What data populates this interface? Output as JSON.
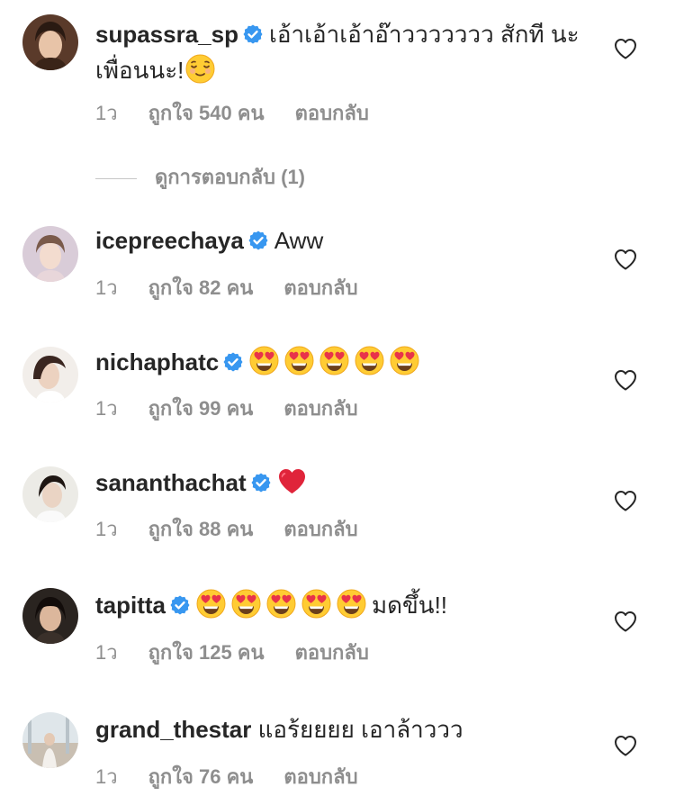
{
  "comments": [
    {
      "username": "supassra_sp",
      "text": "เอ้าเอ้าเอ้าอ๊าววววววว สักที นะเพื่อนนะ!",
      "trailing_emoji": "relieved-face",
      "time": "1ว",
      "likes": "ถูกใจ 540 คน",
      "reply": "ตอบกลับ"
    },
    {
      "username": "icepreechaya",
      "text": "Aww",
      "time": "1ว",
      "likes": "ถูกใจ 82 คน",
      "reply": "ตอบกลับ"
    },
    {
      "username": "nichaphatc",
      "text": "",
      "emojis": [
        "heart-eyes",
        "heart-eyes",
        "heart-eyes",
        "heart-eyes",
        "heart-eyes"
      ],
      "time": "1ว",
      "likes": "ถูกใจ 99 คน",
      "reply": "ตอบกลับ"
    },
    {
      "username": "sananthachat",
      "text": "",
      "emojis": [
        "red-heart"
      ],
      "time": "1ว",
      "likes": "ถูกใจ 88 คน",
      "reply": "ตอบกลับ"
    },
    {
      "username": "tapitta",
      "text": "มดขึ้น!!",
      "emojis": [
        "heart-eyes",
        "heart-eyes",
        "heart-eyes",
        "heart-eyes",
        "heart-eyes"
      ],
      "time": "1ว",
      "likes": "ถูกใจ 125 คน",
      "reply": "ตอบกลับ"
    },
    {
      "username": "grand_thestar",
      "text": "แอร้ยยยย เอาล้าววว",
      "time": "1ว",
      "likes": "ถูกใจ 76 คน",
      "reply": "ตอบกลับ"
    }
  ],
  "view_replies": "ดูการตอบกลับ (1)",
  "colors": {
    "text": "#262626",
    "secondary": "#8e8e8e",
    "verified": "#3897f0",
    "divider": "#c7c7c7"
  },
  "icons": {
    "verified": "verified-badge-icon",
    "like": "heart-outline-icon"
  }
}
